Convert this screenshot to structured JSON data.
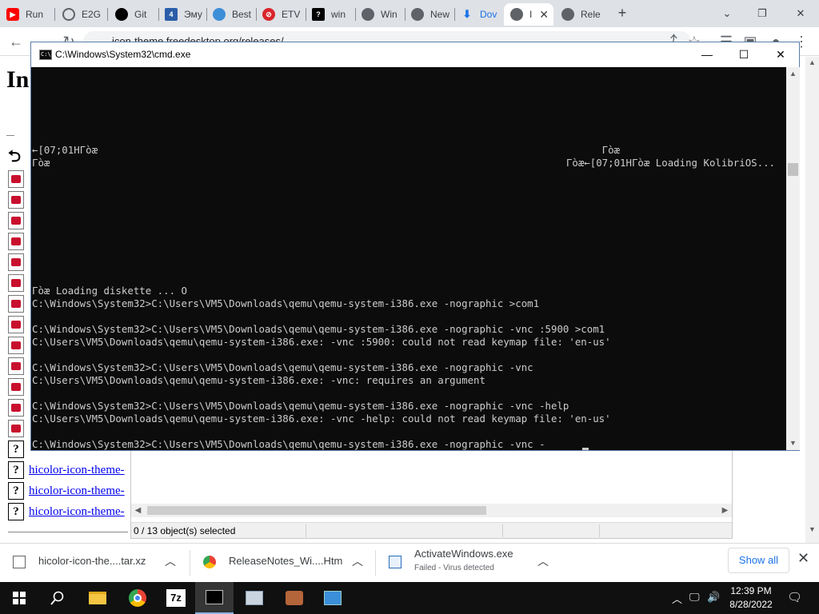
{
  "browser": {
    "tabs": [
      {
        "label": "Run",
        "icon": "youtube-icon",
        "color": "#ff0000"
      },
      {
        "label": "E2G",
        "icon": "globe-icon",
        "color": "#5f6368"
      },
      {
        "label": "Git",
        "icon": "github-icon",
        "color": "#000000"
      },
      {
        "label": "Эму",
        "icon": "4pda-icon",
        "color": "#2a5ca8"
      },
      {
        "label": "Best",
        "icon": "blog-icon",
        "color": "#3d8ed8"
      },
      {
        "label": "ETV",
        "icon": "ban-icon",
        "color": "#d8262b"
      },
      {
        "label": "win",
        "icon": "wine-icon",
        "color": "#000000"
      },
      {
        "label": "Win",
        "icon": "globe-icon",
        "color": "#5f6368"
      },
      {
        "label": "New",
        "icon": "chrome-icon",
        "color": "#5f6368"
      },
      {
        "label": "Dov",
        "icon": "download-icon",
        "color": "#1a73e8"
      },
      {
        "label": "I",
        "icon": "globe-icon",
        "color": "#5f6368",
        "active": true
      },
      {
        "label": "Rele",
        "icon": "globe-icon",
        "color": "#5f6368"
      }
    ],
    "url": "icon-theme.freedesktop.org/releases/"
  },
  "webpage": {
    "title": "In",
    "files": [
      "hicolor-icon-theme-",
      "hicolor-icon-theme-",
      "hicolor-icon-theme-"
    ]
  },
  "explorer": {
    "status": "0 / 13 object(s) selected"
  },
  "cmd": {
    "title": "C:\\Windows\\System32\\cmd.exe",
    "icon_text": "C:\\",
    "lines_left_top": [
      "←[07;01HΓòæ",
      "Γòæ"
    ],
    "lines_right_top": [
      "Γòæ",
      "Γòæ←[07;01HΓòæ Loading KolibriOS..."
    ],
    "lines_bottom": [
      "Γòæ Loading diskette ... O",
      "C:\\Windows\\System32>C:\\Users\\VM5\\Downloads\\qemu\\qemu-system-i386.exe -nographic >com1",
      "",
      "C:\\Windows\\System32>C:\\Users\\VM5\\Downloads\\qemu\\qemu-system-i386.exe -nographic -vnc :5900 >com1",
      "C:\\Users\\VM5\\Downloads\\qemu\\qemu-system-i386.exe: -vnc :5900: could not read keymap file: 'en-us'",
      "",
      "C:\\Windows\\System32>C:\\Users\\VM5\\Downloads\\qemu\\qemu-system-i386.exe -nographic -vnc",
      "C:\\Users\\VM5\\Downloads\\qemu\\qemu-system-i386.exe: -vnc: requires an argument",
      "",
      "C:\\Windows\\System32>C:\\Users\\VM5\\Downloads\\qemu\\qemu-system-i386.exe -nographic -vnc -help",
      "C:\\Users\\VM5\\Downloads\\qemu\\qemu-system-i386.exe: -vnc -help: could not read keymap file: 'en-us'",
      "",
      "C:\\Windows\\System32>C:\\Users\\VM5\\Downloads\\qemu\\qemu-system-i386.exe -nographic -vnc -"
    ]
  },
  "downloads": {
    "items": [
      {
        "name": "hicolor-icon-the....tar.xz",
        "sub": ""
      },
      {
        "name": "ReleaseNotes_Wi....Htm",
        "sub": ""
      },
      {
        "name": "ActivateWindows.exe",
        "sub": "Failed - Virus detected"
      }
    ],
    "show_all": "Show all"
  },
  "taskbar": {
    "time": "12:39 PM",
    "date": "8/28/2022",
    "seven_zip_label": "7z"
  }
}
